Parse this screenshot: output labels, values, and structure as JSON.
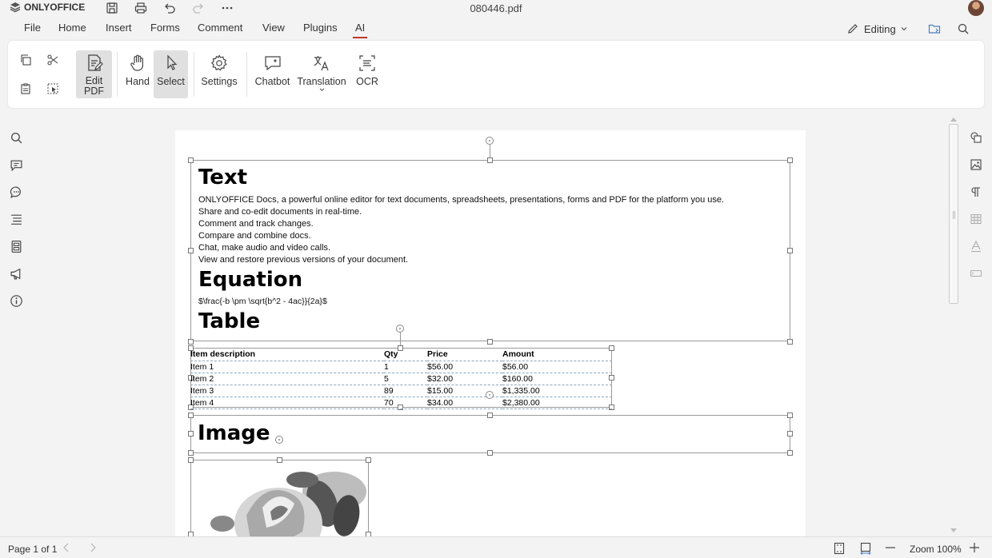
{
  "app": {
    "name": "ONLYOFFICE",
    "doc_title": "080446.pdf"
  },
  "menu": {
    "file": "File",
    "home": "Home",
    "insert": "Insert",
    "forms": "Forms",
    "comment": "Comment",
    "view": "View",
    "plugins": "Plugins",
    "ai": "AI"
  },
  "mode": {
    "label": "Editing"
  },
  "ribbon": {
    "edit_pdf_line1": "Edit",
    "edit_pdf_line2": "PDF",
    "hand": "Hand",
    "select": "Select",
    "settings": "Settings",
    "chatbot": "Chatbot",
    "translation": "Translation",
    "ocr": "OCR"
  },
  "doc": {
    "h_text": "Text",
    "lines": [
      "ONLYOFFICE Docs, a powerful online editor for text documents, spreadsheets, presentations, forms and PDF for the platform you use.",
      "Share and co-edit documents in real-time.",
      "Comment and track changes.",
      "Compare and combine docs.",
      "Chat, make audio and video calls.",
      "View and restore previous versions of your document."
    ],
    "h_equation": "Equation",
    "equation": "$\\frac{-b \\pm \\sqrt{b^2 - 4ac}}{2a}$",
    "h_table": "Table",
    "table": {
      "headers": [
        "Item description",
        "Qty",
        "Price",
        "Amount"
      ],
      "rows": [
        [
          "Item 1",
          "1",
          "$56.00",
          "$56.00"
        ],
        [
          "Item 2",
          "5",
          "$32.00",
          "$160.00"
        ],
        [
          "Item 3",
          "89",
          "$15.00",
          "$1,335.00"
        ],
        [
          "Item 4",
          "70",
          "$34.00",
          "$2,380.00"
        ]
      ]
    },
    "h_image": "Image"
  },
  "status": {
    "page": "Page 1 of 1",
    "zoom": "Zoom 100%"
  }
}
